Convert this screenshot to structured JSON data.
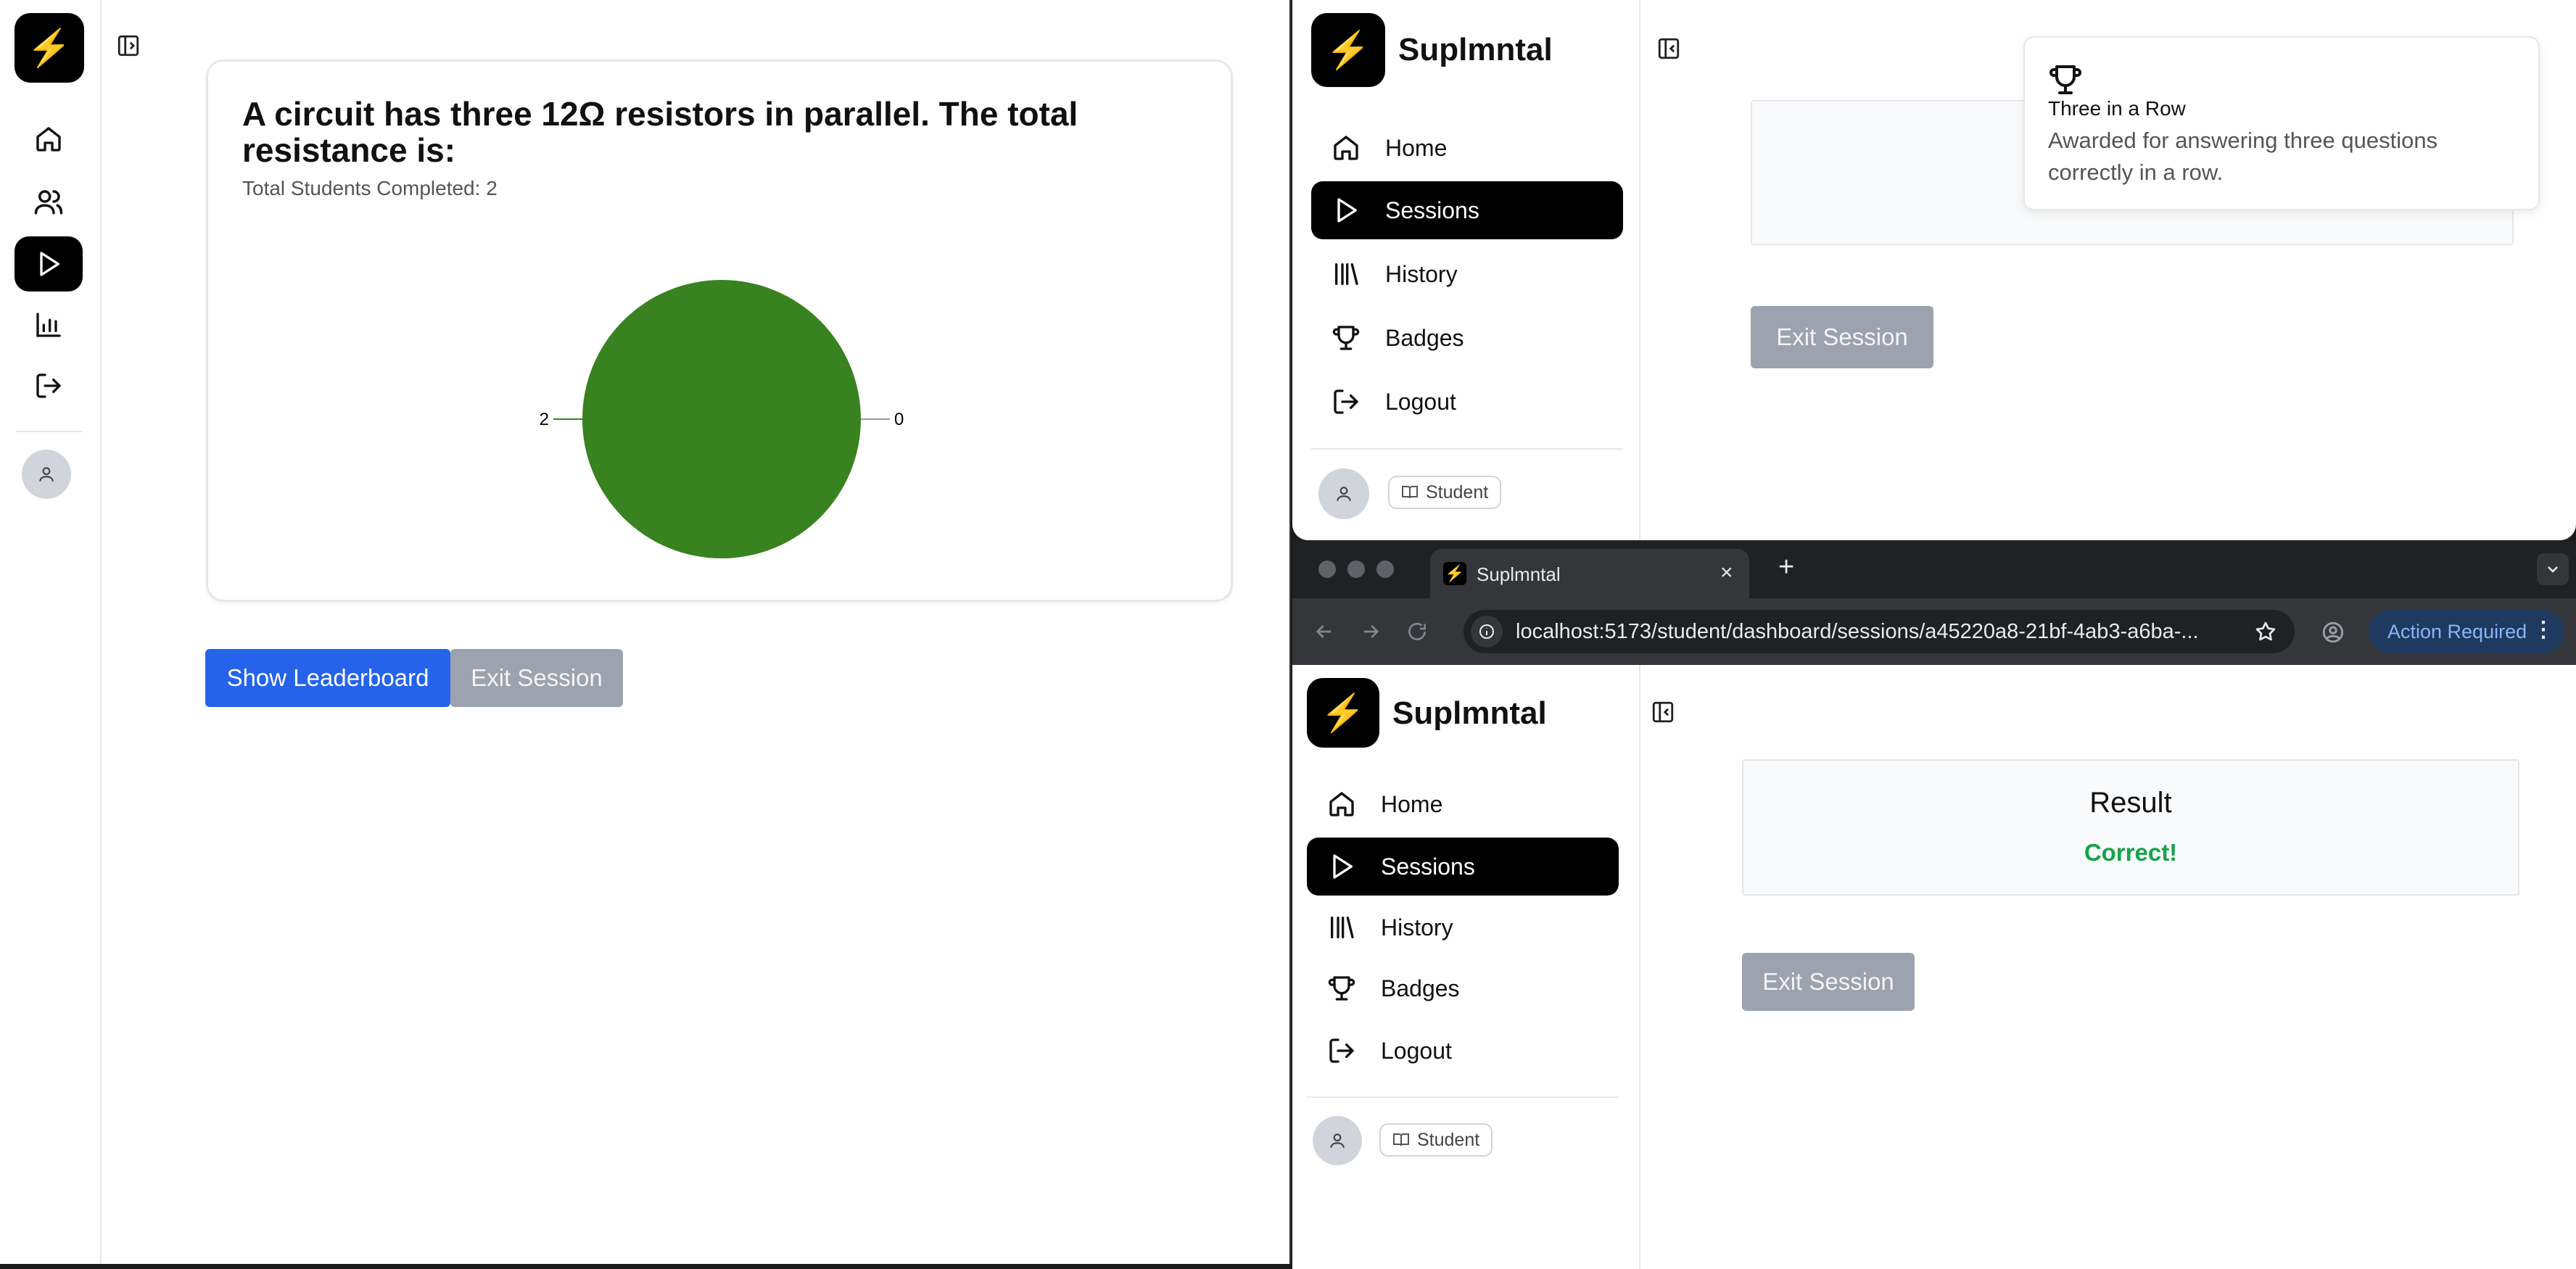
{
  "left": {
    "logo_glyph": "⚡",
    "nav_icons": [
      "home-icon",
      "users-icon",
      "play-icon",
      "bar-chart-icon",
      "logout-icon"
    ],
    "active_nav": "play-icon",
    "question": "A circuit has three 12Ω resistors in parallel. The total resistance is:",
    "completed": "Total Students Completed: 2",
    "buttons": {
      "leaderboard": "Show Leaderboard",
      "exit": "Exit Session"
    }
  },
  "chart_data": {
    "type": "pie",
    "title": "",
    "slices": [
      {
        "label": "2",
        "value": 2,
        "color": "#38821f"
      },
      {
        "label": "0",
        "value": 0,
        "color": "#2563eb"
      }
    ]
  },
  "app": {
    "brand": "Suplmntal",
    "logo_glyph": "⚡",
    "nav": [
      {
        "label": "Home",
        "icon": "home-icon"
      },
      {
        "label": "Sessions",
        "icon": "play-icon",
        "active": true
      },
      {
        "label": "History",
        "icon": "library-icon"
      },
      {
        "label": "Badges",
        "icon": "trophy-icon"
      },
      {
        "label": "Logout",
        "icon": "logout-icon"
      }
    ],
    "role": "Student",
    "exit_label": "Exit Session"
  },
  "toast": {
    "title": "Three in a Row",
    "description": "Awarded for answering three questions correctly in a row."
  },
  "browser": {
    "tab_title": "Suplmntal",
    "url": "localhost:5173/student/dashboard/sessions/a45220a8-21bf-4ab3-a6ba-...",
    "action_label": "Action Required"
  },
  "result": {
    "title": "Result",
    "status": "Correct!",
    "status_color": "#16a34a"
  }
}
